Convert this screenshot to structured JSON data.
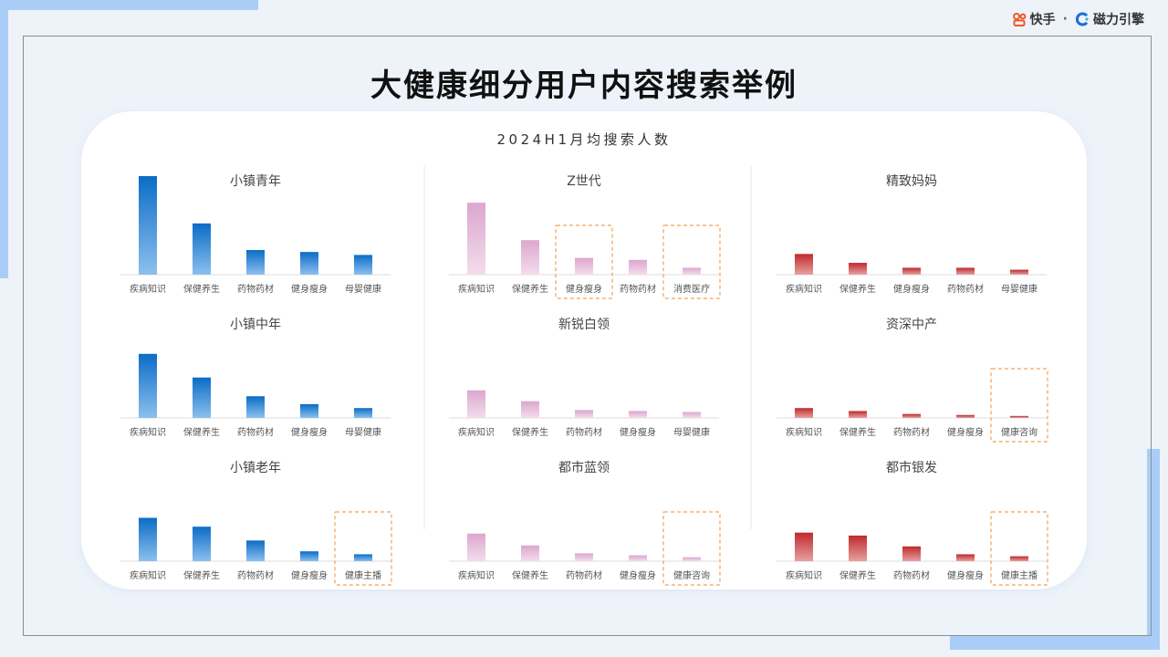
{
  "brand": {
    "kuaishou": "快手",
    "separator": "·",
    "cili": "磁力引擎",
    "icons": [
      "kuaishou-logo-icon",
      "cili-logo-icon"
    ],
    "colors": {
      "kuaishou": "#f05a28",
      "cili": "#1a6fd8"
    }
  },
  "title": "大健康细分用户内容搜索举例",
  "subtitle": "2024H1月均搜索人数",
  "colors": {
    "blue": "#0b6cc6",
    "pink": "#dba7ce",
    "red": "#bf2a2d",
    "highlight_border": "#f5a054"
  },
  "chart_data": [
    {
      "type": "bar",
      "title": "小镇青年",
      "color": "blue",
      "categories": [
        "疾病知识",
        "保健养生",
        "药物药材",
        "健身瘦身",
        "母婴健康"
      ],
      "values": [
        100,
        52,
        25,
        23,
        20
      ],
      "ylim": [
        0,
        100
      ],
      "highlighted": []
    },
    {
      "type": "bar",
      "title": "Z世代",
      "color": "pink",
      "categories": [
        "疾病知识",
        "保健养生",
        "健身瘦身",
        "药物药材",
        "消费医疗"
      ],
      "values": [
        73,
        35,
        17,
        15,
        7
      ],
      "ylim": [
        0,
        100
      ],
      "highlighted": [
        2,
        4
      ]
    },
    {
      "type": "bar",
      "title": "精致妈妈",
      "color": "red",
      "categories": [
        "疾病知识",
        "保健养生",
        "健身瘦身",
        "药物药材",
        "母婴健康"
      ],
      "values": [
        21,
        12,
        7,
        7,
        5
      ],
      "ylim": [
        0,
        100
      ],
      "highlighted": []
    },
    {
      "type": "bar",
      "title": "小镇中年",
      "color": "blue",
      "categories": [
        "疾病知识",
        "保健养生",
        "药物药材",
        "健身瘦身",
        "母婴健康"
      ],
      "values": [
        65,
        41,
        22,
        14,
        10
      ],
      "ylim": [
        0,
        100
      ],
      "highlighted": []
    },
    {
      "type": "bar",
      "title": "新锐白领",
      "color": "pink",
      "categories": [
        "疾病知识",
        "保健养生",
        "药物药材",
        "健身瘦身",
        "母婴健康"
      ],
      "values": [
        28,
        17,
        8,
        7,
        6
      ],
      "ylim": [
        0,
        100
      ],
      "highlighted": []
    },
    {
      "type": "bar",
      "title": "资深中产",
      "color": "red",
      "categories": [
        "疾病知识",
        "保健养生",
        "药物药材",
        "健身瘦身",
        "健康咨询"
      ],
      "values": [
        10,
        7,
        4,
        3,
        2
      ],
      "ylim": [
        0,
        100
      ],
      "highlighted": [
        4
      ]
    },
    {
      "type": "bar",
      "title": "小镇老年",
      "color": "blue",
      "categories": [
        "疾病知识",
        "保健养生",
        "药物药材",
        "健身瘦身",
        "健康主播"
      ],
      "values": [
        44,
        35,
        21,
        10,
        7
      ],
      "ylim": [
        0,
        100
      ],
      "highlighted": [
        4
      ]
    },
    {
      "type": "bar",
      "title": "都市蓝领",
      "color": "pink",
      "categories": [
        "疾病知识",
        "保健养生",
        "药物药材",
        "健身瘦身",
        "健康咨询"
      ],
      "values": [
        28,
        16,
        8,
        6,
        4
      ],
      "ylim": [
        0,
        100
      ],
      "highlighted": [
        4
      ]
    },
    {
      "type": "bar",
      "title": "都市银发",
      "color": "red",
      "categories": [
        "疾病知识",
        "保健养生",
        "药物药材",
        "健身瘦身",
        "健康主播"
      ],
      "values": [
        29,
        26,
        15,
        7,
        5
      ],
      "ylim": [
        0,
        100
      ],
      "highlighted": [
        4
      ]
    }
  ]
}
